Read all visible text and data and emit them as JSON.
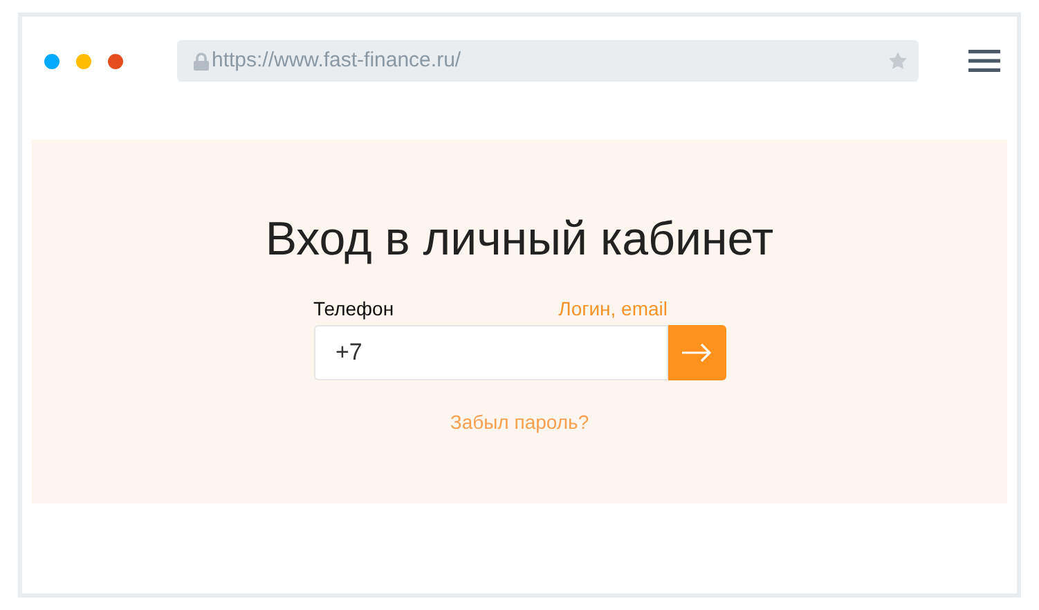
{
  "browser": {
    "window_dots": [
      {
        "color": "#00aaff"
      },
      {
        "color": "#ffbb00"
      },
      {
        "color": "#e54d1e"
      }
    ],
    "url": "https://www.fast-finance.ru/"
  },
  "login": {
    "title": "Вход в личный кабинет",
    "tabs": [
      {
        "label": "Телефон",
        "selected": true
      },
      {
        "label": "Логин, email",
        "selected": false
      }
    ],
    "phone_field": {
      "value": "+7"
    },
    "forgot_link": "Забыл пароль?"
  }
}
